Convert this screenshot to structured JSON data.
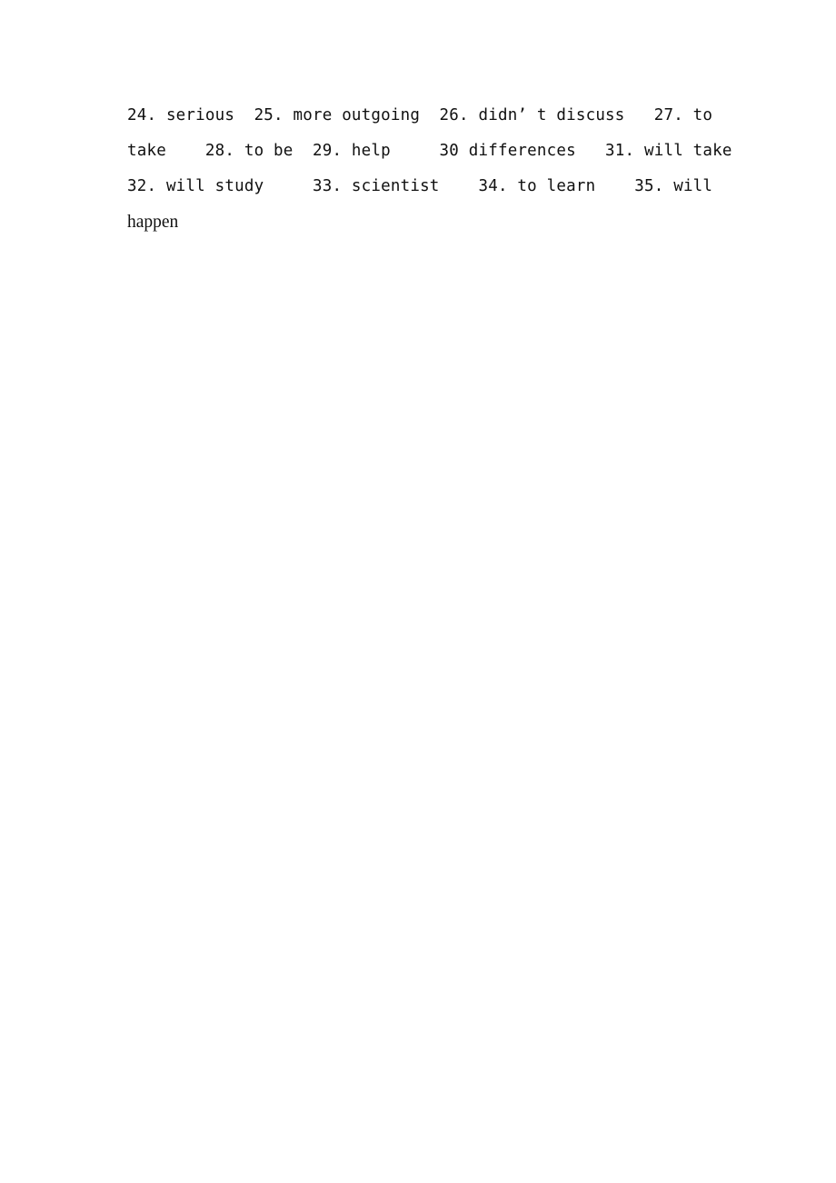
{
  "document": {
    "page_background": "#ffffff",
    "text_color": "#000000",
    "lines": [
      {
        "id": "line-1",
        "text": "24. serious  25. more outgoing  26. didn’ t discuss   27. to",
        "style": "mono"
      },
      {
        "id": "line-2",
        "text": "take    28. to be  29. help     30 differences   31. will take",
        "style": "mono"
      },
      {
        "id": "line-3",
        "text": "32. will study     33. scientist    34. to learn    35. will",
        "style": "mono"
      },
      {
        "id": "line-4",
        "text": "happen",
        "style": "serif"
      }
    ],
    "answers": [
      {
        "number": "24.",
        "answer": "serious"
      },
      {
        "number": "25.",
        "answer": "more outgoing"
      },
      {
        "number": "26.",
        "answer": "didn’ t discuss"
      },
      {
        "number": "27.",
        "answer": "to take"
      },
      {
        "number": "28.",
        "answer": "to be"
      },
      {
        "number": "29.",
        "answer": "help"
      },
      {
        "number": "30",
        "answer": "differences"
      },
      {
        "number": "31.",
        "answer": "will take"
      },
      {
        "number": "32.",
        "answer": "will study"
      },
      {
        "number": "33.",
        "answer": "scientist"
      },
      {
        "number": "34.",
        "answer": "to learn"
      },
      {
        "number": "35.",
        "answer": "will happen"
      }
    ]
  }
}
